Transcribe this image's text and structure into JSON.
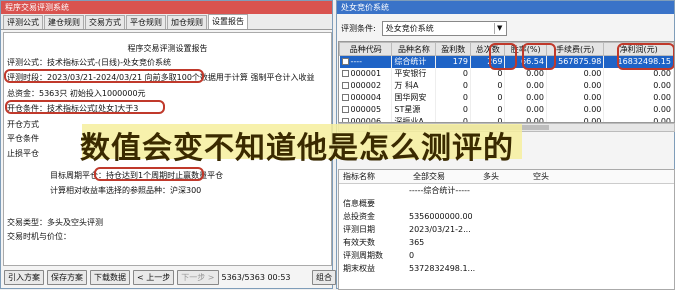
{
  "left": {
    "title": "程序交易评测系统",
    "tabs": [
      "评测公式",
      "建仓规则",
      "交易方式",
      "平仓规则",
      "加仓规则",
      "设置报告"
    ],
    "report": {
      "heading": "程序交易评测设置报告",
      "formula": "评测公式：技术指标公式-(日线)-处女竞价系统",
      "period": "评测时段：2023/03/21-2024/03/21 向前多取100个数据用于计算 强制平仓计入收益",
      "capital": "总资金：5363只 初始投入1000000元",
      "open_cond": "开仓条件：技术指标公式[处女]大于3",
      "open_way": "开仓方式",
      "close_cond": "平仓条件",
      "stop_loss": "止损平仓",
      "target_close": "目标周期平仓：持仓达到1个周期时止赢数量平仓",
      "benchmark": "计算相对收益率选择的参照品种：沪深300",
      "trade_type": "交易类型：多头及空头评测",
      "trade_time": "交易时机与价位："
    },
    "buttons": [
      "引入方案",
      "保存方案",
      "下载数据",
      "< 上一步",
      "下一步 >"
    ],
    "status": "5363/5363  00:53"
  },
  "right": {
    "title": "处女竞价系统",
    "cond_label": "评测条件:",
    "cond_value": "处女竞价系统",
    "columns": [
      "品种代码",
      "品种名称",
      "盈利数",
      "总次数",
      "胜率(%)",
      "手续费(元)",
      "净利润(元)"
    ],
    "rows": [
      {
        "code": "----",
        "name": "综合统计",
        "win": "179",
        "total": "269",
        "rate": "66.54",
        "fee": "567875.98",
        "profit": "16832498.15",
        "selected": true
      },
      {
        "code": "000001",
        "name": "平安银行",
        "win": "0",
        "total": "0",
        "rate": "0.00",
        "fee": "0.00",
        "profit": "0.00",
        "selected": false
      },
      {
        "code": "000002",
        "name": "万 科A",
        "win": "0",
        "total": "0",
        "rate": "0.00",
        "fee": "0.00",
        "profit": "0.00",
        "selected": false
      },
      {
        "code": "000004",
        "name": "国华网安",
        "win": "0",
        "total": "0",
        "rate": "0.00",
        "fee": "0.00",
        "profit": "0.00",
        "selected": false
      },
      {
        "code": "000005",
        "name": "ST星源",
        "win": "0",
        "total": "0",
        "rate": "0.00",
        "fee": "0.00",
        "profit": "0.00",
        "selected": false
      },
      {
        "code": "000006",
        "name": "深振业A",
        "win": "0",
        "total": "0",
        "rate": "0.00",
        "fee": "0.00",
        "profit": "0.00",
        "selected": false
      }
    ],
    "stats_header": [
      "指标名称",
      "全部交易",
      "多头",
      "空头"
    ],
    "stats_rows": [
      {
        "k": "",
        "v": "-----综合统计-----"
      },
      {
        "k": "信息概要",
        "v": ""
      },
      {
        "k": "总投资金",
        "v": "5356000000.00"
      },
      {
        "k": "评测日期",
        "v": "2023/03/21-2..."
      },
      {
        "k": "有效天数",
        "v": "365"
      },
      {
        "k": "评测周期数",
        "v": "0"
      },
      {
        "k": "期末权益",
        "v": "5372832498.1..."
      }
    ],
    "side_button": "组合"
  },
  "overlay_text": "数值会变不知道他是怎么测评的",
  "colors": {
    "left_title": "#d9534f",
    "right_title": "#3a73c8",
    "highlight": "#c0392b",
    "selection": "#1e63c6",
    "overlay_bg": "#f6ee9d"
  }
}
